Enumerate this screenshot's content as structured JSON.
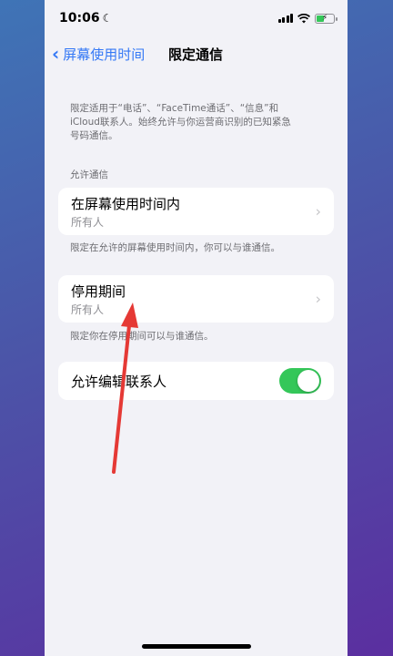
{
  "status": {
    "time": "10:06"
  },
  "nav": {
    "back_label": "屏幕使用时间",
    "title": "限定通信"
  },
  "intro": {
    "line1": "限定适用于“电话”、“FaceTime通话”、“信息”和",
    "line2": "iCloud联系人。始终允许与你运营商识别的已知紧急",
    "line3": "号码通信。"
  },
  "allowed": {
    "header": "允许通信",
    "during_screen_time": {
      "title": "在屏幕使用时间内",
      "value": "所有人"
    },
    "footer": "限定在允许的屏幕使用时间内，你可以与谁通信。"
  },
  "downtime": {
    "title": "停用期间",
    "value": "所有人",
    "footer": "限定你在停用期间可以与谁通信。"
  },
  "edit_contacts": {
    "label": "允许编辑联系人",
    "enabled": true
  },
  "colors": {
    "accent": "#3478f6",
    "toggle_on": "#34c759",
    "arrow": "#e53935"
  }
}
